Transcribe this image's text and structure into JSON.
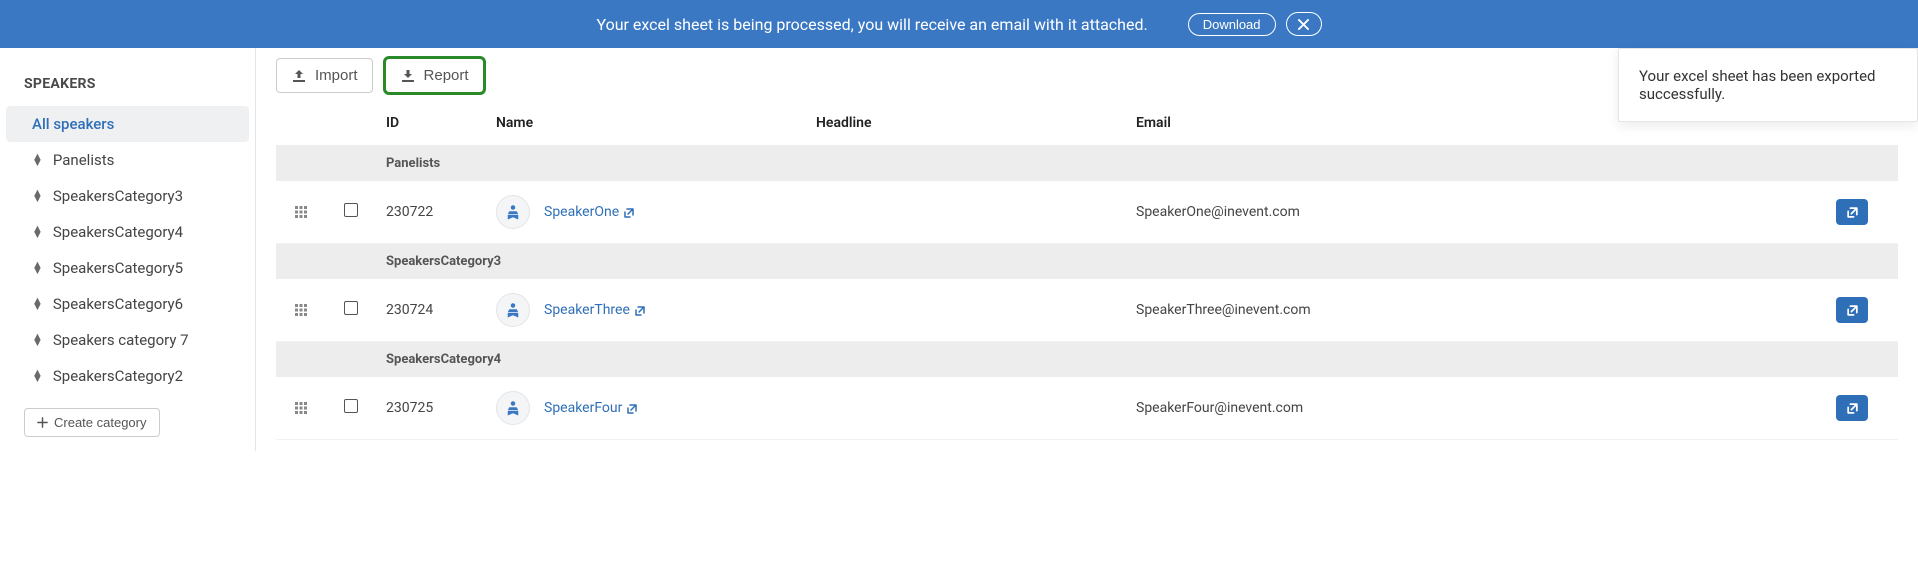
{
  "notification": {
    "message": "Your excel sheet is being processed, you will receive an email with it attached.",
    "download_label": "Download"
  },
  "toast": {
    "message": "Your excel sheet has been exported successfully."
  },
  "sidebar": {
    "title": "SPEAKERS",
    "all_label": "All speakers",
    "categories": [
      {
        "label": "Panelists"
      },
      {
        "label": "SpeakersCategory3"
      },
      {
        "label": "SpeakersCategory4"
      },
      {
        "label": "SpeakersCategory5"
      },
      {
        "label": "SpeakersCategory6"
      },
      {
        "label": "Speakers category 7"
      },
      {
        "label": "SpeakersCategory2"
      }
    ],
    "create_label": "Create category"
  },
  "toolbar": {
    "import_label": "Import",
    "report_label": "Report"
  },
  "table": {
    "headers": {
      "id": "ID",
      "name": "Name",
      "headline": "Headline",
      "email": "Email"
    },
    "groups": [
      {
        "title": "Panelists",
        "rows": [
          {
            "id": "230722",
            "name": "SpeakerOne",
            "headline": "",
            "email": "SpeakerOne@inevent.com"
          }
        ]
      },
      {
        "title": "SpeakersCategory3",
        "rows": [
          {
            "id": "230724",
            "name": "SpeakerThree",
            "headline": "",
            "email": "SpeakerThree@inevent.com"
          }
        ]
      },
      {
        "title": "SpeakersCategory4",
        "rows": [
          {
            "id": "230725",
            "name": "SpeakerFour",
            "headline": "",
            "email": "SpeakerFour@inevent.com"
          }
        ]
      }
    ]
  }
}
